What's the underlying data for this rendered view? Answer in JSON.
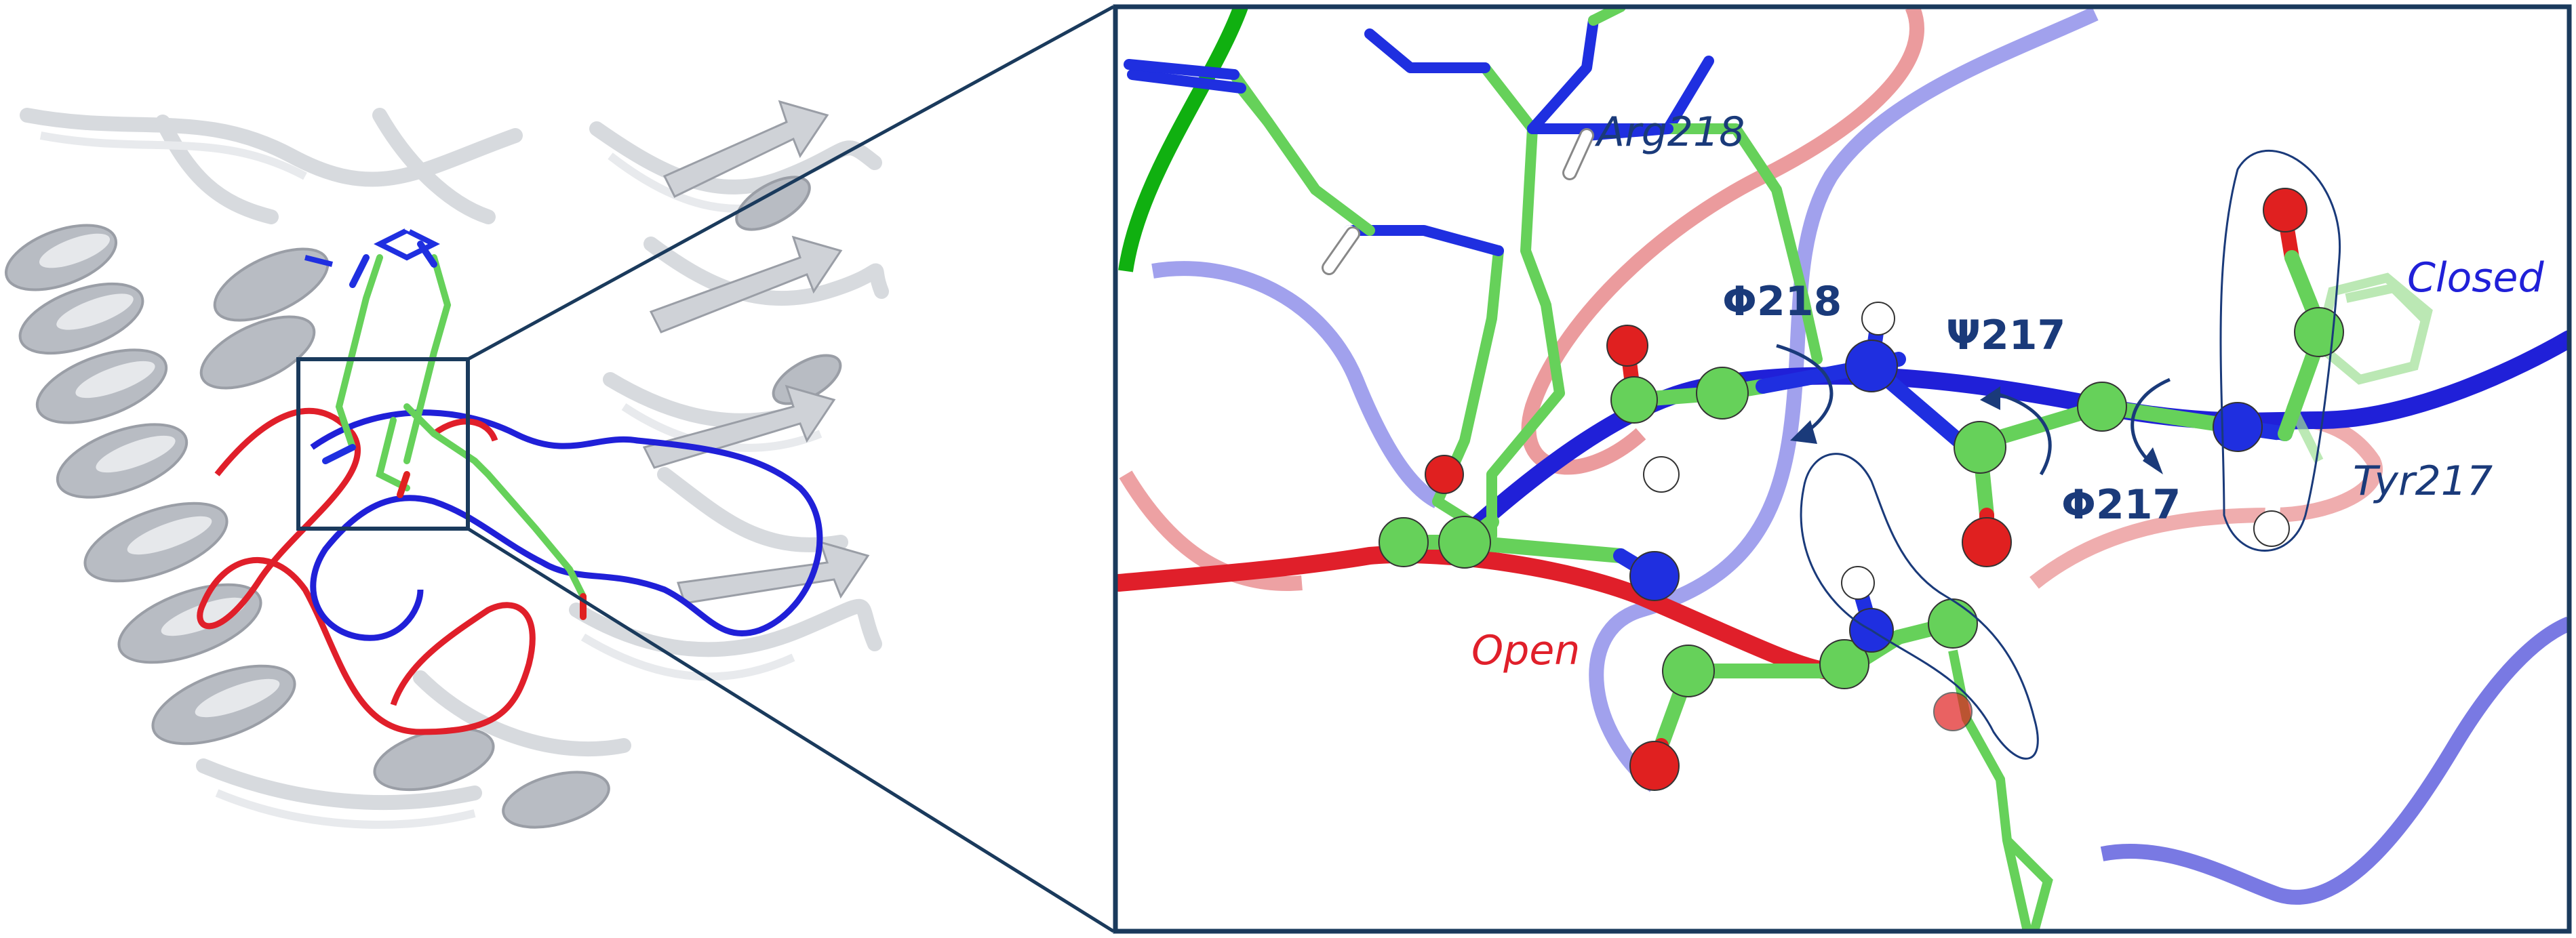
{
  "residue_labels": {
    "arg": "Arg218",
    "tyr": "Tyr217"
  },
  "state_labels": {
    "closed": "Closed",
    "open": "Open"
  },
  "angle_labels": {
    "phi218": "Φ218",
    "psi217": "Ψ217",
    "phi217": "Φ217"
  },
  "colors": {
    "closed_loop": "#2020d8",
    "open_loop": "#e01f2a",
    "carbon": "#66d15a",
    "nitrogen": "#1f2fe0",
    "oxygen": "#e02020",
    "hydrogen": "#ffffff",
    "frame": "#1a3a5c",
    "label_dark": "#1a3a7a",
    "protein_gray": "#c8ccd2"
  }
}
